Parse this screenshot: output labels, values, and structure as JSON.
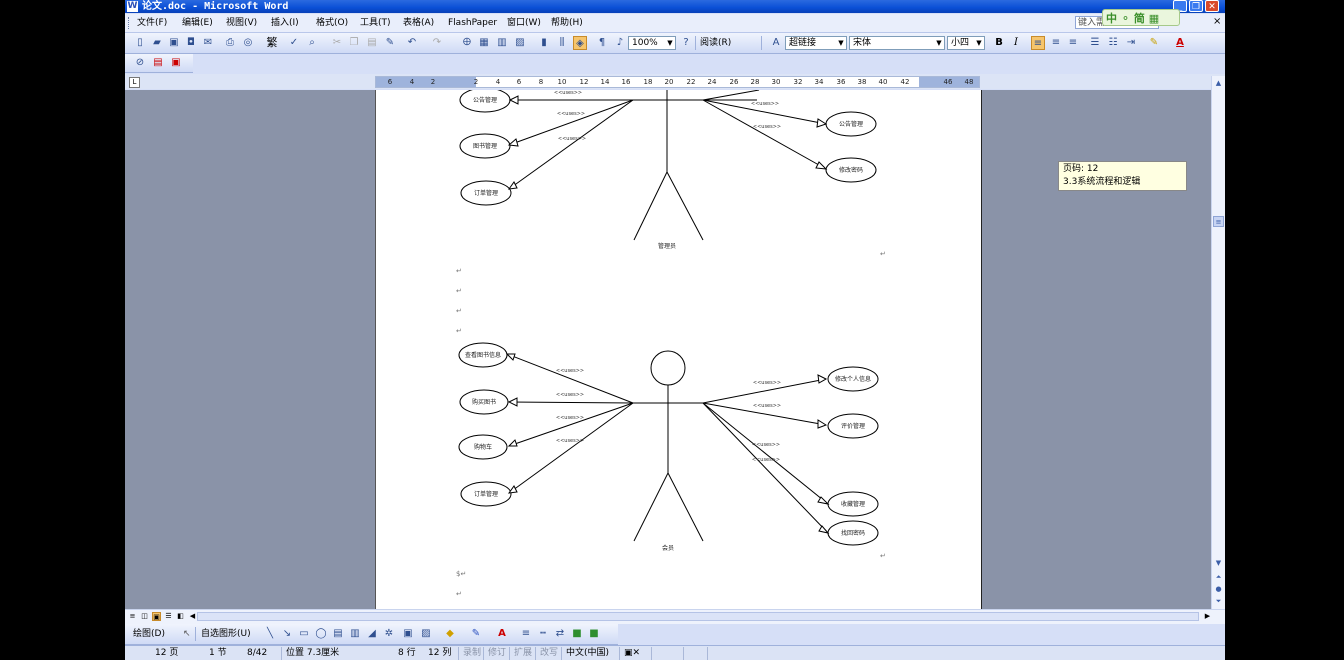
{
  "window": {
    "title": "论文.doc - Microsoft Word",
    "app_icon": "W",
    "buttons": {
      "minimize": "_",
      "restore": "❐",
      "close": "✕"
    }
  },
  "menu": {
    "items": [
      "文件(F)",
      "编辑(E)",
      "视图(V)",
      "插入(I)",
      "格式(O)",
      "工具(T)",
      "表格(A)",
      "FlashPaper",
      "窗口(W)",
      "帮助(H)"
    ],
    "ask_placeholder": "键入需",
    "ime_label": "中 ⚬ 简 ▦",
    "close": "×"
  },
  "toolbar": {
    "zoom": "100%",
    "read_label": "阅读(R)",
    "style": "超链接",
    "font": "宋体",
    "size": "小四",
    "bold": "B",
    "italic": "I",
    "traditional": "繁",
    "font_color_icon": "A"
  },
  "ruler": {
    "ticks": [
      "6",
      "4",
      "2",
      "2",
      "4",
      "6",
      "8",
      "10",
      "12",
      "14",
      "16",
      "18",
      "20",
      "22",
      "24",
      "26",
      "28",
      "30",
      "32",
      "34",
      "36",
      "38",
      "40",
      "42",
      "46",
      "48"
    ]
  },
  "document": {
    "diagram1": {
      "actor_label": "管理员",
      "left_cases": [
        "公告管理",
        "图书管理",
        "订单管理"
      ],
      "right_cases": [
        "公告管理",
        "修改密码"
      ],
      "relation": "<<uses>>"
    },
    "diagram2": {
      "actor_label": "会员",
      "left_cases": [
        "查看图书信息",
        "购买图书",
        "购物车",
        "订单管理"
      ],
      "right_cases": [
        "修改个人信息",
        "评价管理",
        "收藏管理",
        "找回密码"
      ],
      "relation": "<<uses>>"
    },
    "paragraph_mark": "↵",
    "section_mark": "$↵"
  },
  "tooltip": {
    "line1": "页码: 12",
    "line2": "3.3系统流程和逻辑"
  },
  "drawbar": {
    "draw_label": "绘图(D)",
    "autoshape_label": "自选图形(U)"
  },
  "status": {
    "page": "12 页",
    "section": "1 节",
    "page_count": "8/42",
    "position": "位置 7.3厘米",
    "line": "8 行",
    "col": "12 列",
    "rec": "录制",
    "trk": "修订",
    "ext": "扩展",
    "ovr": "改写",
    "language": "中文(中国)"
  },
  "colors": {
    "accent": "#0a4fd6",
    "workspace": "#8a93a8",
    "toolbar": "#d6dff7"
  }
}
